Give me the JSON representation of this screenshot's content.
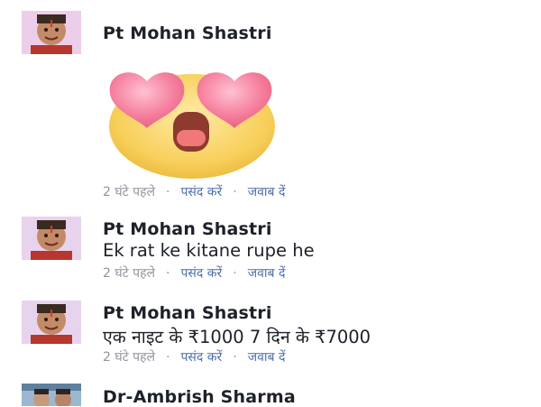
{
  "comments": [
    {
      "author": "Pt Mohan Shastri",
      "text": "",
      "sticker": "heart-eyes-emoji-sticker",
      "time": "2 घंटे पहले",
      "like": "पसंद करें",
      "reply": "जवाब दें"
    },
    {
      "author": "Pt Mohan Shastri",
      "text": "Ek rat ke kitane rupe he",
      "time": "2 घंटे पहले",
      "like": "पसंद करें",
      "reply": "जवाब दें"
    },
    {
      "author": "Pt Mohan Shastri",
      "text": "एक नाइट के ₹1000 7 दिन के ₹7000",
      "time": "2 घंटे पहले",
      "like": "पसंद करें",
      "reply": "जवाब दें"
    },
    {
      "author": "Dr-Ambrish Sharma"
    }
  ],
  "colors": {
    "name": "#1d2129",
    "meta_gray": "#90949c",
    "link_blue": "#4b6ea8",
    "sticker_yellow": "#f7cf5a",
    "heart_pink": "#f06a8e"
  }
}
